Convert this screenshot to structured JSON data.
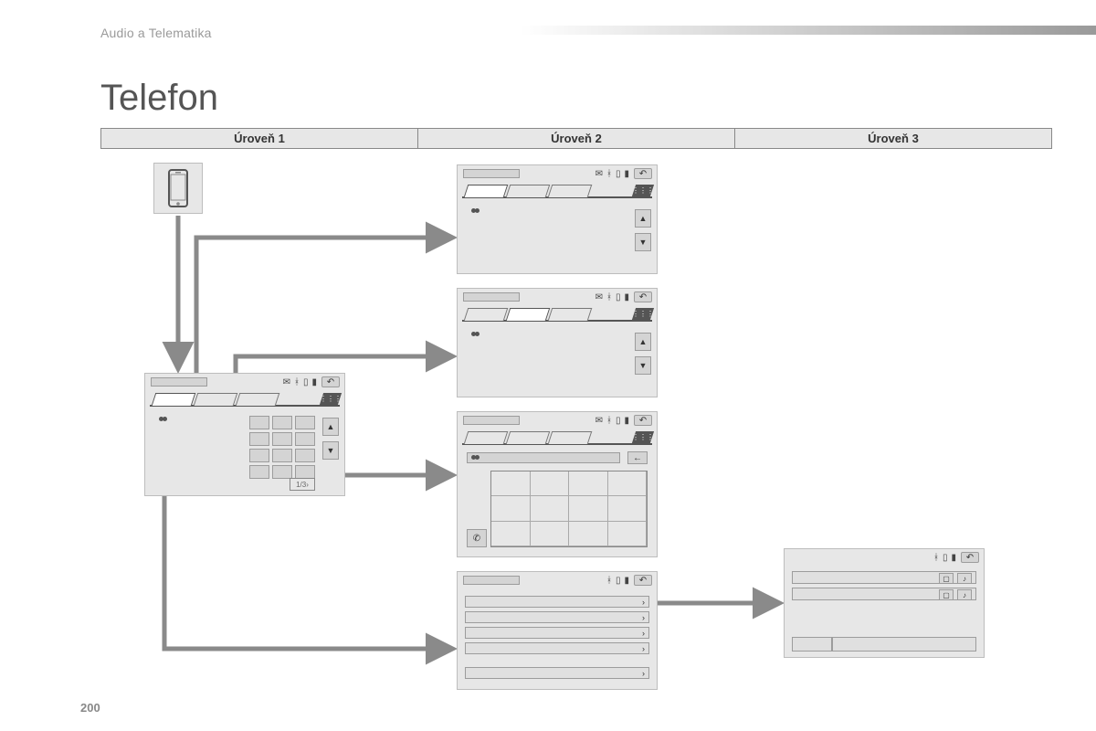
{
  "header": {
    "section": "Audio a Telematika"
  },
  "page": {
    "title": "Telefon",
    "number": "200"
  },
  "levels": [
    "Úroveň 1",
    "Úroveň 2",
    "Úroveň 3"
  ],
  "icons": {
    "phone": "phone-icon",
    "mail": "✉",
    "bluetooth": "ᚼ",
    "device": "▯",
    "battery": "▮",
    "back": "↶",
    "grid": "⋮⋮⋮",
    "up": "▲",
    "down": "▼",
    "call": "✆",
    "backspace": "←",
    "chevron": "›",
    "note": "♪",
    "square": "▢"
  },
  "level1_screen": {
    "page_indicator": "1/3›"
  },
  "settings_rows": 5
}
